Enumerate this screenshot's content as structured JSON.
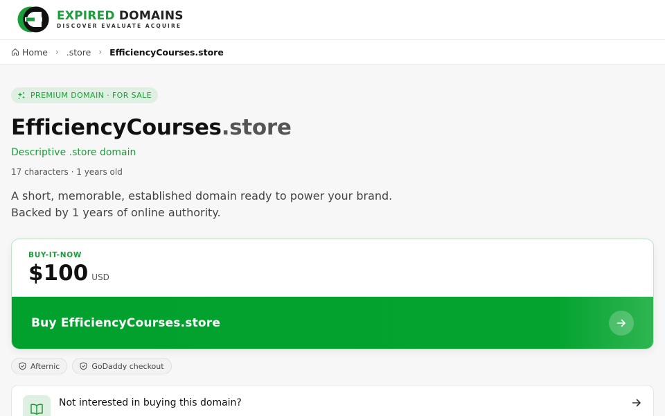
{
  "header": {
    "logo_word_1": "EXPIRED",
    "logo_word_2": "DOMAINS",
    "logo_tagline": "DISCOVER EVALUATE ACQUIRE"
  },
  "breadcrumb": {
    "home": "Home",
    "tld": ".store",
    "current": "EfficiencyCourses.store"
  },
  "domain": {
    "badge": "PREMIUM DOMAIN · FOR SALE",
    "name": "EfficiencyCourses",
    "extension": ".store",
    "subtitle": "Descriptive .store domain",
    "meta": "17 characters · 1 years old",
    "description_line_1": "A short, memorable, established domain ready to power your brand.",
    "description_line_2": "Backed by 1 years of online authority."
  },
  "purchase": {
    "label": "BUY-IT-NOW",
    "price": "$100",
    "currency": "USD",
    "button_label": "Buy EfficiencyCourses.store"
  },
  "chips": [
    "Afternic",
    "GoDaddy checkout"
  ],
  "not_interested": {
    "text": "Not interested in buying this domain?"
  },
  "colors": {
    "brand_green": "#1a9e3a",
    "button_green": "#02a02c"
  },
  "icons": {
    "logo": "ed-logo-icon",
    "home": "home-icon",
    "badge": "sparkle-icon",
    "button": "arrow-right-icon",
    "chip": "shield-icon",
    "not_interested": "book-icon"
  }
}
